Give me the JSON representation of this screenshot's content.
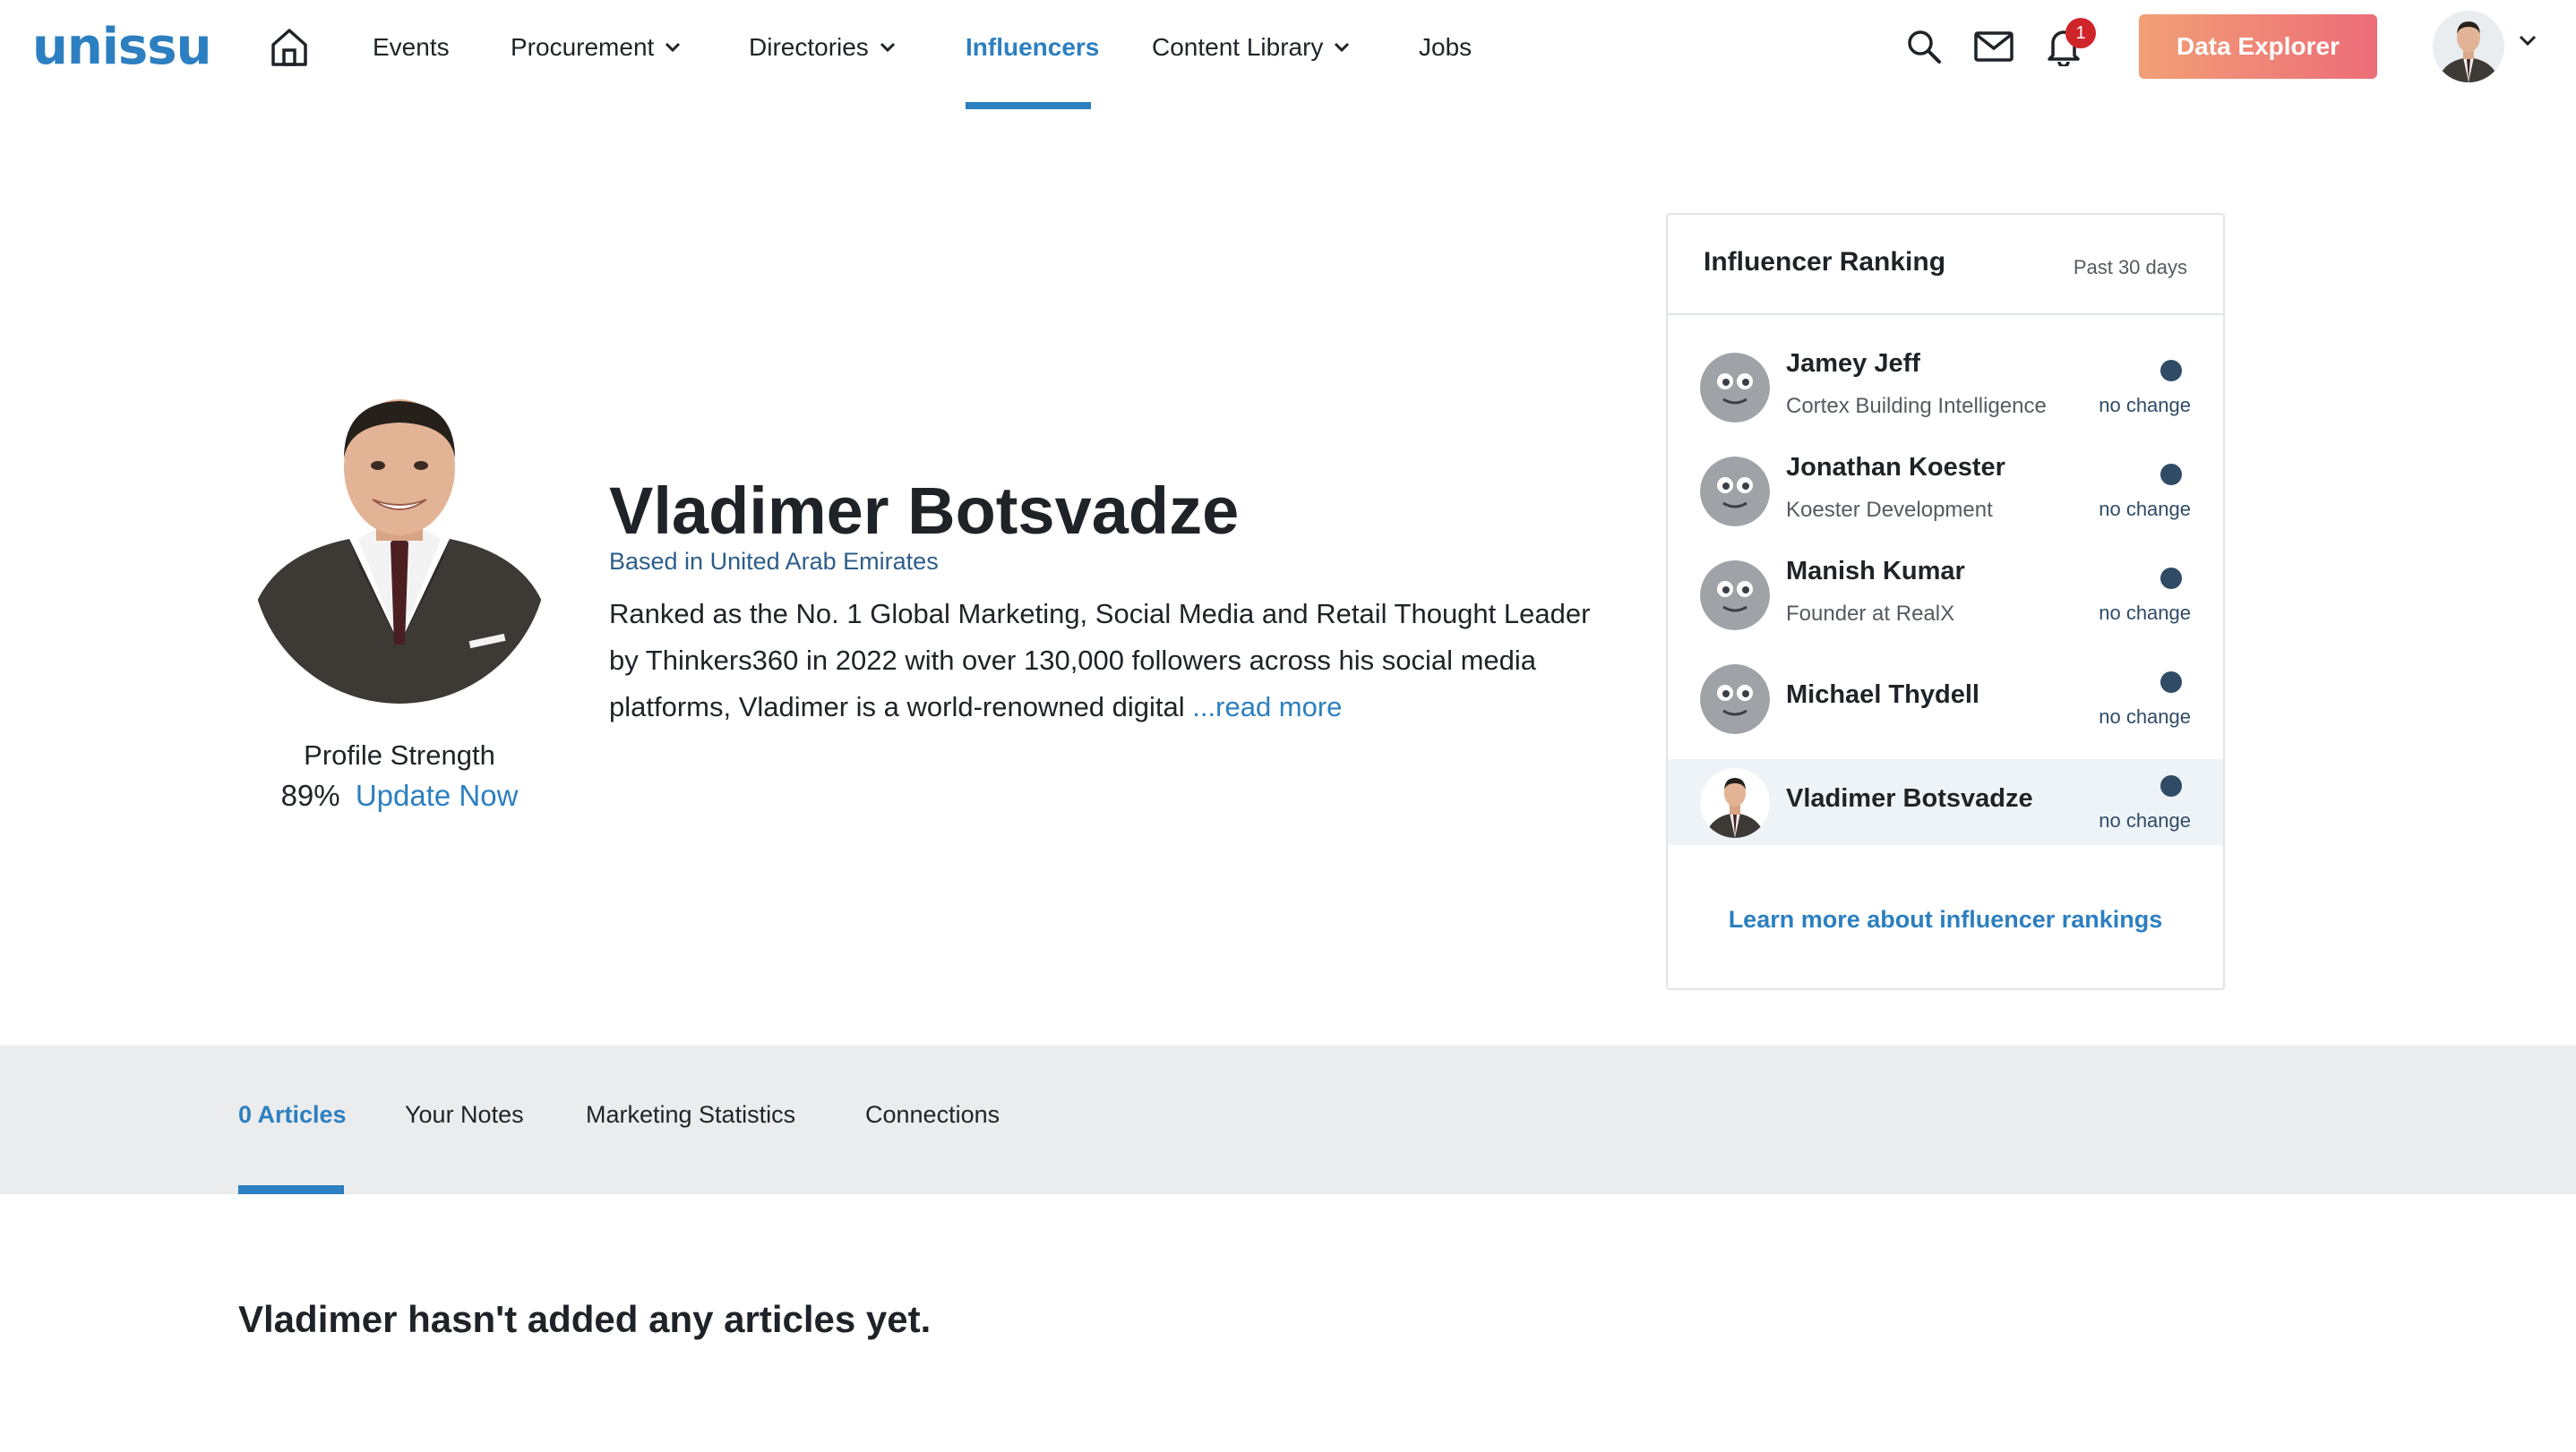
{
  "app": {
    "logo_text": "unissu",
    "brand_color": "#2c7fc0",
    "accent_gradient": [
      "#f29f76",
      "#ec6d78"
    ]
  },
  "nav": {
    "home_icon": "home-icon",
    "items": [
      {
        "label": "Events",
        "dropdown": false,
        "active": false
      },
      {
        "label": "Procurement",
        "dropdown": true,
        "active": false
      },
      {
        "label": "Directories",
        "dropdown": true,
        "active": false
      },
      {
        "label": "Influencers",
        "dropdown": false,
        "active": true
      },
      {
        "label": "Content Library",
        "dropdown": true,
        "active": false
      },
      {
        "label": "Jobs",
        "dropdown": false,
        "active": false
      }
    ],
    "notifications_count": "1",
    "data_explorer_label": "Data Explorer"
  },
  "profile": {
    "name": "Vladimer Botsvadze",
    "location": "Based in United Arab Emirates",
    "bio": "Ranked as the No. 1 Global Marketing, Social Media and Retail Thought Leader by Thinkers360 in 2022 with over 130,000 followers across his social media platforms, Vladimer is a world-renowned digital",
    "read_more": "...read more",
    "strength_label": "Profile Strength",
    "strength_value": "89%",
    "update_label": "Update Now"
  },
  "ranking": {
    "title": "Influencer Ranking",
    "period": "Past 30 days",
    "rows": [
      {
        "name": "Jamey Jeff",
        "org": "Cortex Building Intelligence",
        "change": "no change",
        "avatar": "placeholder"
      },
      {
        "name": "Jonathan Koester",
        "org": "Koester Development",
        "change": "no change",
        "avatar": "placeholder"
      },
      {
        "name": "Manish Kumar",
        "org": "Founder at RealX",
        "change": "no change",
        "avatar": "placeholder"
      },
      {
        "name": "Michael Thydell",
        "org": "",
        "change": "no change",
        "avatar": "placeholder"
      },
      {
        "name": "Vladimer Botsvadze",
        "org": "",
        "change": "no change",
        "avatar": "photo",
        "highlight": true
      }
    ],
    "learn_more": "Learn more about influencer rankings"
  },
  "tabs": [
    {
      "label": "0 Articles",
      "active": true
    },
    {
      "label": "Your Notes",
      "active": false
    },
    {
      "label": "Marketing Statistics",
      "active": false
    },
    {
      "label": "Connections",
      "active": false
    }
  ],
  "empty_message": "Vladimer hasn't added any articles yet."
}
